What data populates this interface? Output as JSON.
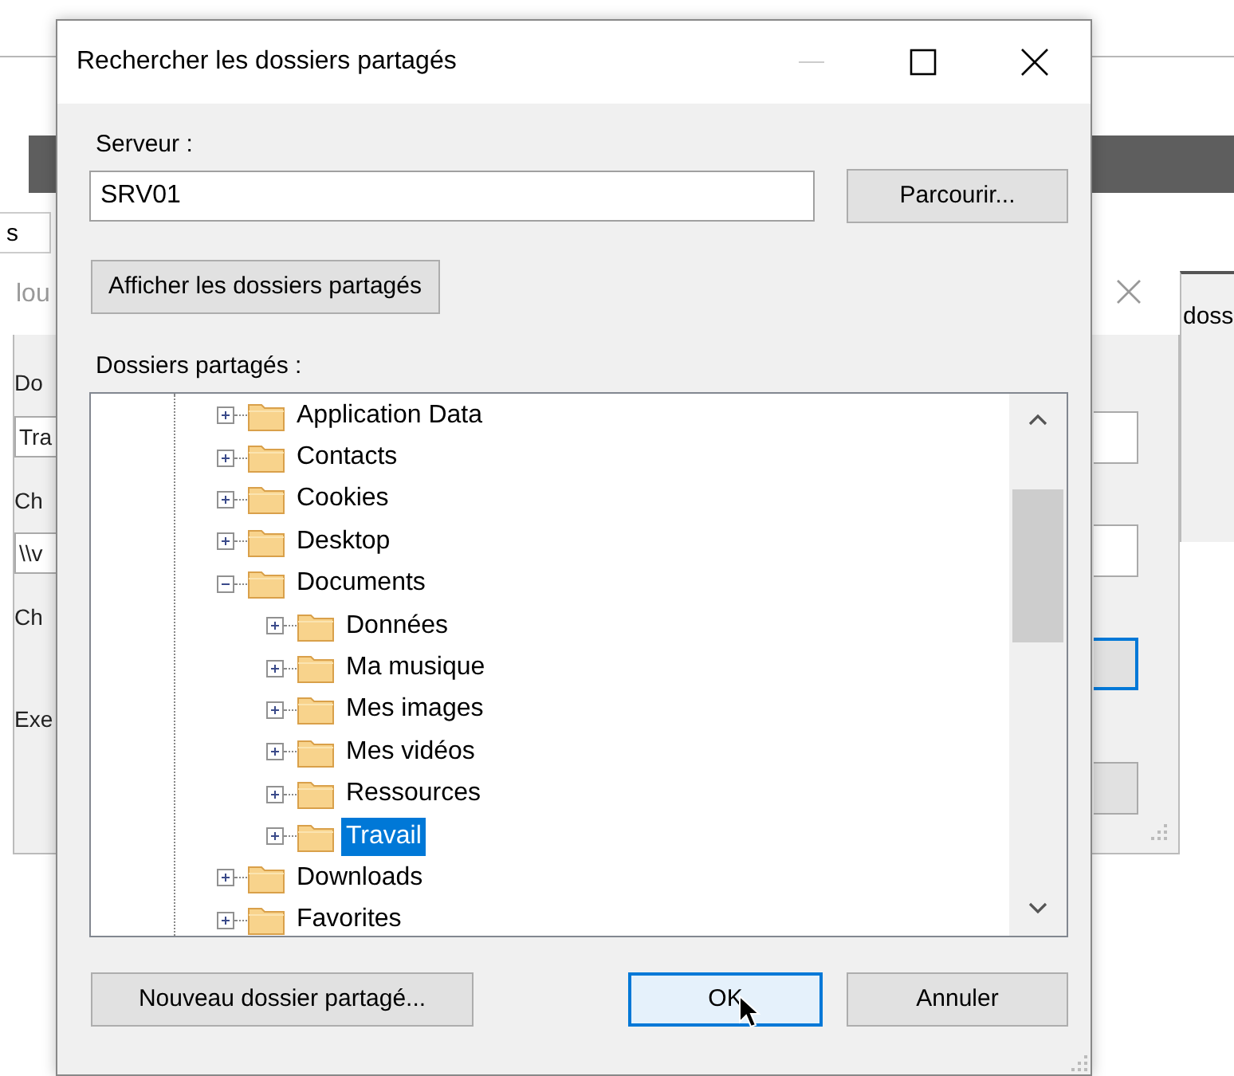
{
  "background": {
    "left_tab": "s",
    "back_window_title": "lou",
    "left_fragments": [
      {
        "kind": "label",
        "text": "Do"
      },
      {
        "kind": "field",
        "text": "Tra"
      },
      {
        "kind": "label",
        "text": "Ch"
      },
      {
        "kind": "field",
        "text": "\\\\v"
      },
      {
        "kind": "label",
        "text": "Ch"
      },
      {
        "kind": "label",
        "text": "Exe"
      }
    ],
    "right_controls": [
      {
        "kind": "field",
        "focused": false
      },
      {
        "kind": "field",
        "focused": false
      },
      {
        "kind": "button",
        "focused": true
      },
      {
        "kind": "button",
        "focused": false
      }
    ],
    "far_right_text": "doss"
  },
  "dialog": {
    "title": "Rechercher les dossiers partagés",
    "minimize_disabled": true,
    "server_label": "Serveur :",
    "server_value": "SRV01",
    "browse_button": "Parcourir...",
    "show_button": "Afficher les dossiers partagés",
    "tree_label": "Dossiers partagés :",
    "tree": [
      {
        "label": "Application Data",
        "expanded": false,
        "selected": false
      },
      {
        "label": "Contacts",
        "expanded": false,
        "selected": false
      },
      {
        "label": "Cookies",
        "expanded": false,
        "selected": false
      },
      {
        "label": "Desktop",
        "expanded": false,
        "selected": false
      },
      {
        "label": "Documents",
        "expanded": true,
        "selected": false,
        "children": [
          {
            "label": "Données",
            "expanded": false,
            "selected": false
          },
          {
            "label": "Ma musique",
            "expanded": false,
            "selected": false
          },
          {
            "label": "Mes images",
            "expanded": false,
            "selected": false
          },
          {
            "label": "Mes vidéos",
            "expanded": false,
            "selected": false
          },
          {
            "label": "Ressources",
            "expanded": false,
            "selected": false
          },
          {
            "label": "Travail",
            "expanded": false,
            "selected": true
          }
        ]
      },
      {
        "label": "Downloads",
        "expanded": false,
        "selected": false
      },
      {
        "label": "Favorites",
        "expanded": false,
        "selected": false
      }
    ],
    "buttons": [
      {
        "label": "Nouveau dossier partagé...",
        "default": false
      },
      {
        "label": "OK",
        "default": true
      },
      {
        "label": "Annuler",
        "default": false
      }
    ]
  }
}
